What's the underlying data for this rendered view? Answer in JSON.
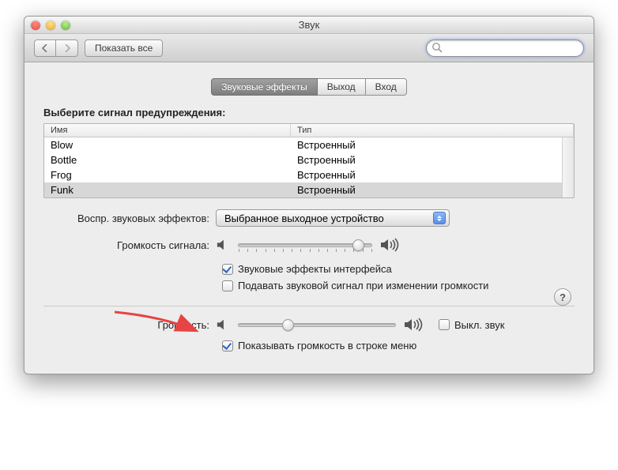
{
  "window": {
    "title": "Звук"
  },
  "toolbar": {
    "show_all": "Показать все",
    "search_placeholder": ""
  },
  "tabs": {
    "effects": "Звуковые эффекты",
    "output": "Выход",
    "input": "Вход"
  },
  "alerts": {
    "prompt": "Выберите сигнал предупреждения:",
    "columns": {
      "name": "Имя",
      "type": "Тип"
    },
    "rows": [
      {
        "name": "Blow",
        "type": "Встроенный"
      },
      {
        "name": "Bottle",
        "type": "Встроенный"
      },
      {
        "name": "Frog",
        "type": "Встроенный"
      },
      {
        "name": "Funk",
        "type": "Встроенный"
      }
    ]
  },
  "playthrough": {
    "label": "Воспр. звуковых эффектов:",
    "value": "Выбранное выходное устройство"
  },
  "alert_volume": {
    "label": "Громкость сигнала:"
  },
  "effects_checks": {
    "ui_sounds": "Звуковые эффекты интерфейса",
    "feedback": "Подавать звуковой сигнал при изменении громкости"
  },
  "output": {
    "label": "Громкость:",
    "mute": "Выкл. звук",
    "menubar": "Показывать громкость в строке меню"
  },
  "help": "?"
}
